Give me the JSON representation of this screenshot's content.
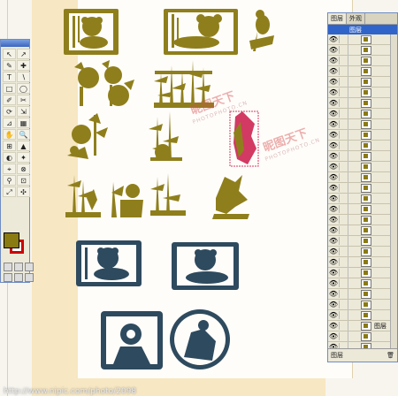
{
  "toolbox": {
    "tools": [
      "↖",
      "↗",
      "✎",
      "✚",
      "T",
      "∖",
      "□",
      "◯",
      "✐",
      "✂",
      "⟳",
      "⇲",
      "⊿",
      "▦",
      "✋",
      "🔍",
      "⊞",
      "▲",
      "◐",
      "✦",
      "⌖",
      "⊗",
      "⚲",
      "⊡",
      "⤢",
      "✣",
      "⌘",
      "▣",
      "◇",
      "⬚",
      "⊕",
      "≡",
      "⊙",
      "⊠"
    ],
    "fill_color": "#8a7a12",
    "stroke_color": "#cc0000"
  },
  "layers_panel": {
    "tabs": [
      "图层",
      "外观"
    ],
    "parent_layer": "图层",
    "sub_layer": "图层",
    "bottom_label": "图层",
    "row_count": 30
  },
  "watermarks": [
    {
      "text": "昵图天下",
      "sub": "PHOTOPHOTO.CN"
    },
    {
      "text": "昵图天下",
      "sub": "PHOTOPHOTO.CN"
    }
  ],
  "footer_url": "http://www.nipic.com/photo/2098"
}
